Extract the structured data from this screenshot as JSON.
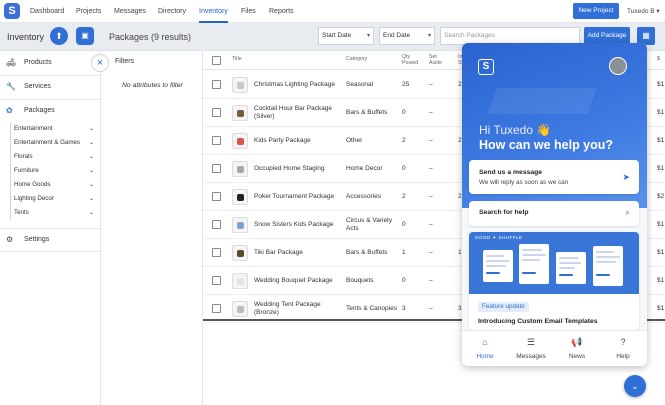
{
  "nav": {
    "logo": "S",
    "items": [
      {
        "label": "Dashboard",
        "active": false
      },
      {
        "label": "Projects",
        "active": false
      },
      {
        "label": "Messages",
        "active": false
      },
      {
        "label": "Directory",
        "active": false
      },
      {
        "label": "Inventory",
        "active": true
      },
      {
        "label": "Files",
        "active": false
      },
      {
        "label": "Reports",
        "active": false
      }
    ],
    "new_project": "New Project",
    "account": "Tuxedo B",
    "account_caret": "▾"
  },
  "toolbar": {
    "title": "Inventory",
    "heading": "Packages (9 results)",
    "start_date": "Start Date",
    "end_date": "End Date",
    "search_placeholder": "Search Packages",
    "add_package": "Add Package"
  },
  "sidebar": {
    "products": "Products",
    "services": "Services",
    "packages": "Packages",
    "subitems": [
      "Entertainment",
      "Entertainment & Games",
      "Florals",
      "Furniture",
      "Home Goods",
      "Lighting Decor",
      "Tents"
    ],
    "settings": "Settings",
    "icons": {
      "products": "couch-icon",
      "services": "wrench-icon",
      "packages": "packages-icon",
      "settings": "gear-icon"
    }
  },
  "filters": {
    "header": "Filters",
    "empty": "No attributes to filter",
    "close_glyph": "×"
  },
  "table": {
    "headers": {
      "title": "Title",
      "category": "Category",
      "qty": "Qty\nPosted",
      "set": "Set\nAside",
      "inc": "In\nSt",
      "price": "$"
    },
    "rows": [
      {
        "title": "Christmas Lighting Package",
        "category": "Seasonal",
        "qty": "25",
        "set": "–",
        "inc": "25",
        "price": "$1",
        "color": "#c9c9c9"
      },
      {
        "title": "Cocktail Hour Bar Package (Silver)",
        "category": "Bars & Buffets",
        "qty": "0",
        "set": "–",
        "inc": "",
        "price": "$1",
        "color": "#7a5a3c"
      },
      {
        "title": "Kids Party Package",
        "category": "Other",
        "qty": "2",
        "set": "–",
        "inc": "2",
        "price": "$1",
        "color": "#d9534f"
      },
      {
        "title": "Occupied Home Staging",
        "category": "Home Decor",
        "qty": "0",
        "set": "–",
        "inc": "",
        "price": "$1",
        "color": "#a7a7a7"
      },
      {
        "title": "Poker Tournament Package",
        "category": "Accessories",
        "qty": "2",
        "set": "–",
        "inc": "2",
        "price": "$2",
        "color": "#222222"
      },
      {
        "title": "Snow Sisters Kids Package",
        "category": "Circus & Variety Acts",
        "qty": "0",
        "set": "–",
        "inc": "",
        "price": "$1",
        "color": "#7fa3c8"
      },
      {
        "title": "Tiki Bar Package",
        "category": "Bars & Buffets",
        "qty": "1",
        "set": "–",
        "inc": "1",
        "price": "$1",
        "color": "#5b4a2a"
      },
      {
        "title": "Wedding Bouquet Package",
        "category": "Bouquets",
        "qty": "0",
        "set": "–",
        "inc": "",
        "price": "$1",
        "color": "#e4e4e4"
      },
      {
        "title": "Wedding Tent Package (Bronze)",
        "category": "Tents & Canopies",
        "qty": "3",
        "set": "–",
        "inc": "3",
        "price": "$1",
        "color": "#bdbdbd"
      }
    ]
  },
  "widget": {
    "logo": "S",
    "greeting": "Hi Tuxedo 👋",
    "help": "How can we help you?",
    "send_title": "Send us a message",
    "send_sub": "We will reply as soon as we can",
    "send_arrow": "➤",
    "search_title": "Search for help",
    "search_icon": "⌕",
    "news_brand": "GOOD ✦ SHUFFLE",
    "news_badge": "Feature update",
    "news_title": "Introducing Custom Email Templates",
    "tabs": [
      {
        "label": "Home",
        "icon": "⌂",
        "active": true
      },
      {
        "label": "Messages",
        "icon": "☰",
        "active": false
      },
      {
        "label": "News",
        "icon": "📢",
        "active": false
      },
      {
        "label": "Help",
        "icon": "?",
        "active": false
      }
    ]
  },
  "fab": {
    "glyph": "⌄"
  }
}
